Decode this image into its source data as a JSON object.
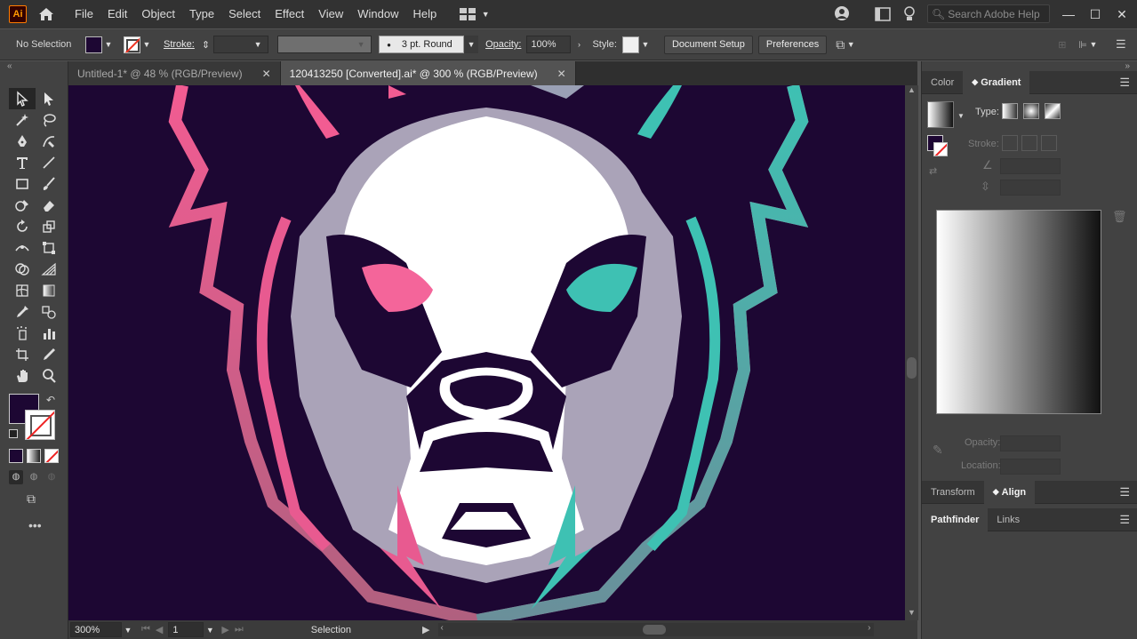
{
  "app": {
    "logo": "Ai",
    "name": "Adobe Illustrator"
  },
  "menu": [
    "File",
    "Edit",
    "Object",
    "Type",
    "Select",
    "Effect",
    "View",
    "Window",
    "Help"
  ],
  "search": {
    "placeholder": "Search Adobe Help"
  },
  "control": {
    "selection": "No Selection",
    "stroke_label": "Stroke:",
    "brush": "3 pt. Round",
    "opacity_label": "Opacity:",
    "opacity": "100%",
    "style_label": "Style:",
    "document_setup": "Document Setup",
    "preferences": "Preferences"
  },
  "tabs": [
    {
      "label": "Untitled-1* @ 48 % (RGB/Preview)",
      "active": false
    },
    {
      "label": "120413250 [Converted].ai* @ 300 % (RGB/Preview)",
      "active": true
    }
  ],
  "status": {
    "zoom": "300%",
    "page": "1",
    "tool": "Selection"
  },
  "panel": {
    "tabs1": [
      "Color",
      "Gradient"
    ],
    "type_label": "Type:",
    "stroke_label": "Stroke:",
    "opacity_label": "Opacity:",
    "location_label": "Location:",
    "tabs2": [
      "Transform",
      "Align"
    ],
    "tabs3": [
      "Pathfinder",
      "Links"
    ]
  },
  "colors": {
    "fill": "#1d0733",
    "canvas": "#1d0733",
    "pink": "#f05a8c",
    "teal": "#3dbfb0",
    "gray": "#a9a0b5",
    "white": "#ffffff"
  }
}
